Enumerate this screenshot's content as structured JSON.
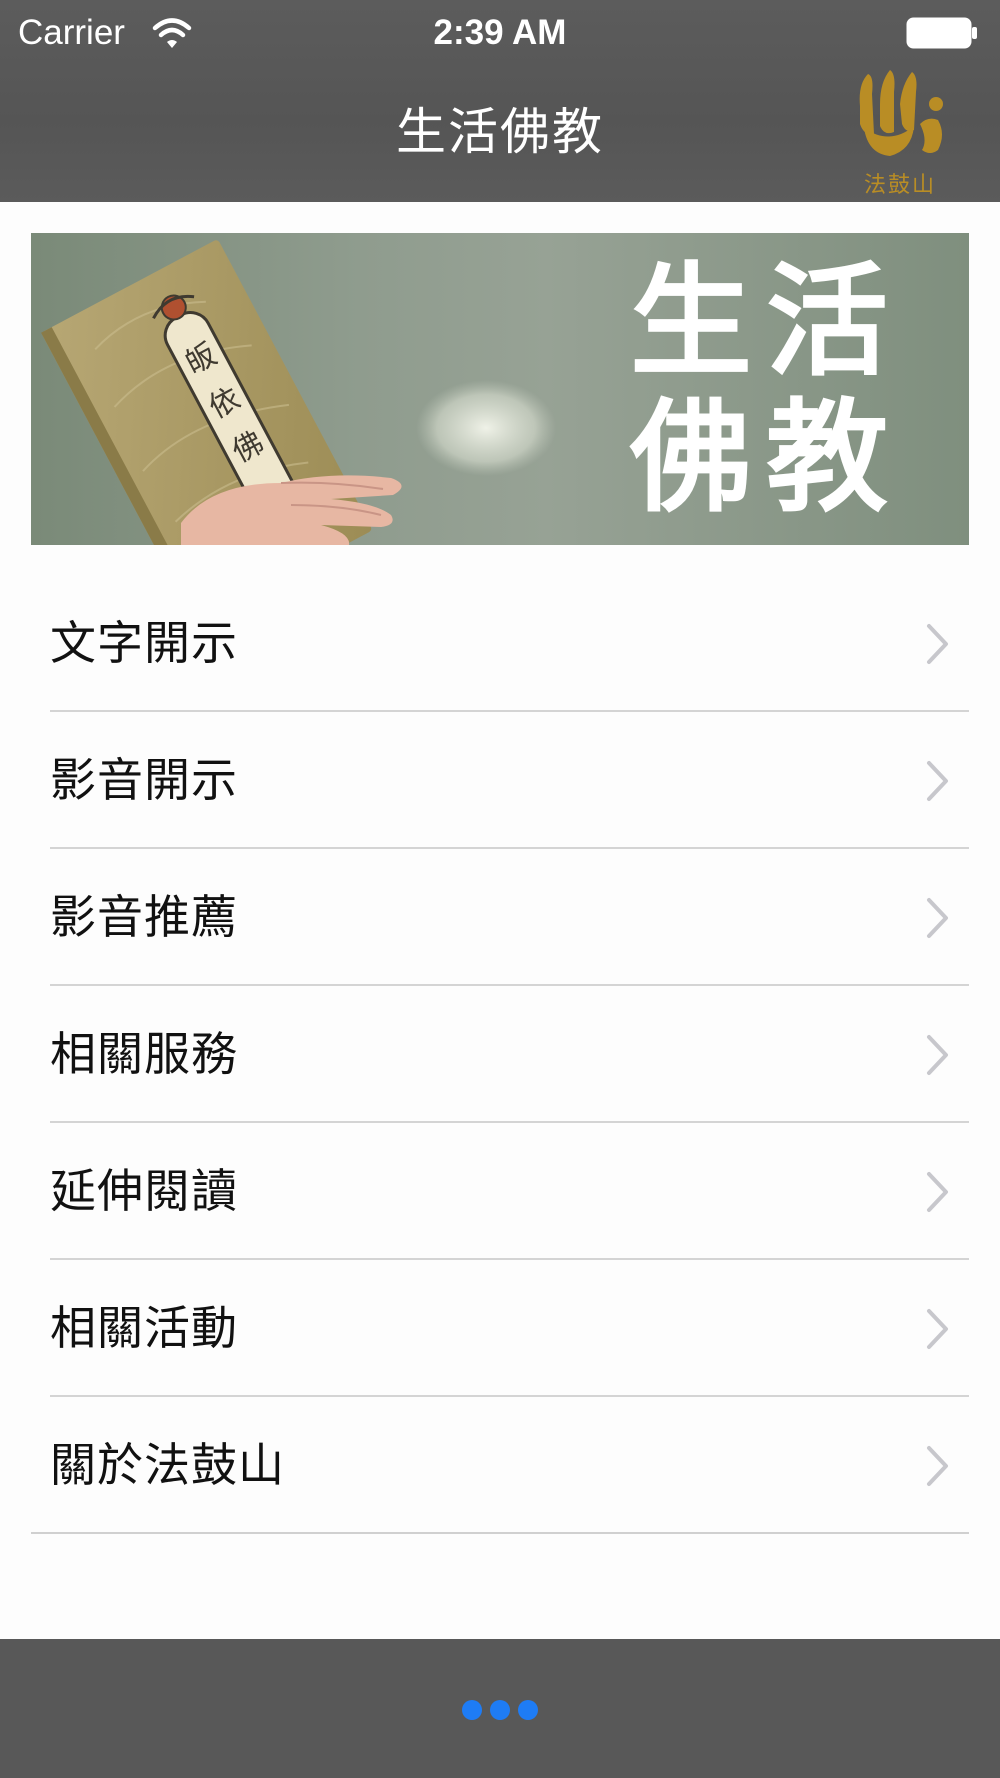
{
  "status_bar": {
    "carrier": "Carrier",
    "time": "2:39 AM"
  },
  "nav_bar": {
    "title": "生活佛教",
    "logo_caption": "法鼓山"
  },
  "banner": {
    "line_1": "生活",
    "line_2": "佛教",
    "book_title": "皈依佛"
  },
  "menu": {
    "items": [
      {
        "label": "文字開示"
      },
      {
        "label": "影音開示"
      },
      {
        "label": "影音推薦"
      },
      {
        "label": "相關服務"
      },
      {
        "label": "延伸閱讀"
      },
      {
        "label": "相關活動"
      },
      {
        "label": "關於法鼓山"
      }
    ]
  },
  "pager": {
    "page_count": 3,
    "active_color": "#1e7cf5"
  },
  "colors": {
    "bar_background": "#585858",
    "logo_gold": "#b98d25",
    "separator": "#d4d4d4"
  },
  "icons": [
    "wifi-icon",
    "battery-icon",
    "chevron-right-icon",
    "page-dot"
  ]
}
